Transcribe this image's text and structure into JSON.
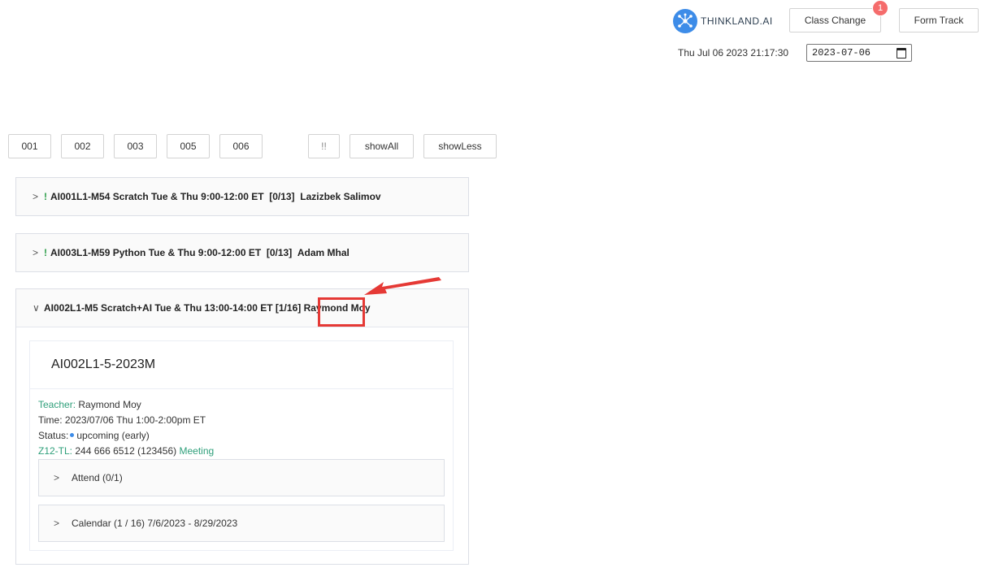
{
  "header": {
    "logo_text": "THINKLAND.AI",
    "class_change_label": "Class Change",
    "class_change_badge": "1",
    "form_track_label": "Form Track",
    "clock": "Thu Jul 06 2023 21:17:30",
    "date_value": "2023-07-06"
  },
  "filters": {
    "buttons": [
      "001",
      "002",
      "003",
      "005",
      "006"
    ],
    "bang": "!!",
    "show_all": "showAll",
    "show_less": "showLess"
  },
  "classes": [
    {
      "expanded": false,
      "flag": "!",
      "title": "AI001L1-M54 Scratch Tue & Thu 9:00-12:00 ET",
      "count": "[0/13]",
      "teacher": "Lazizbek Salimov"
    },
    {
      "expanded": false,
      "flag": "!",
      "title": "AI003L1-M59 Python Tue & Thu 9:00-12:00 ET",
      "count": "[0/13]",
      "teacher": "Adam Mhal"
    },
    {
      "expanded": true,
      "flag": "",
      "title": "AI002L1-M5 Scratch+AI Tue & Thu 13:00-14:00 ET",
      "count": "[1/16]",
      "teacher": "Raymond Moy"
    }
  ],
  "detail": {
    "card_title": "AI002L1-5-2023M",
    "teacher_label": "Teacher:",
    "teacher_value": "Raymond Moy",
    "time_label": "Time:",
    "time_value": "2023/07/06 Thu 1:00-2:00pm ET",
    "status_label": "Status:",
    "status_value": "upcoming (early)",
    "zoom_label": "Z12-TL:",
    "zoom_value": "244 666 6512 (123456)",
    "meeting_link": "Meeting",
    "attend": "Attend (0/1)",
    "calendar": "Calendar (1 / 16) 7/6/2023 - 8/29/2023"
  },
  "colors": {
    "accent": "#3d8ce8",
    "green": "#2e9f7a",
    "highlight": "#e53935",
    "badge": "#f56c6c"
  }
}
